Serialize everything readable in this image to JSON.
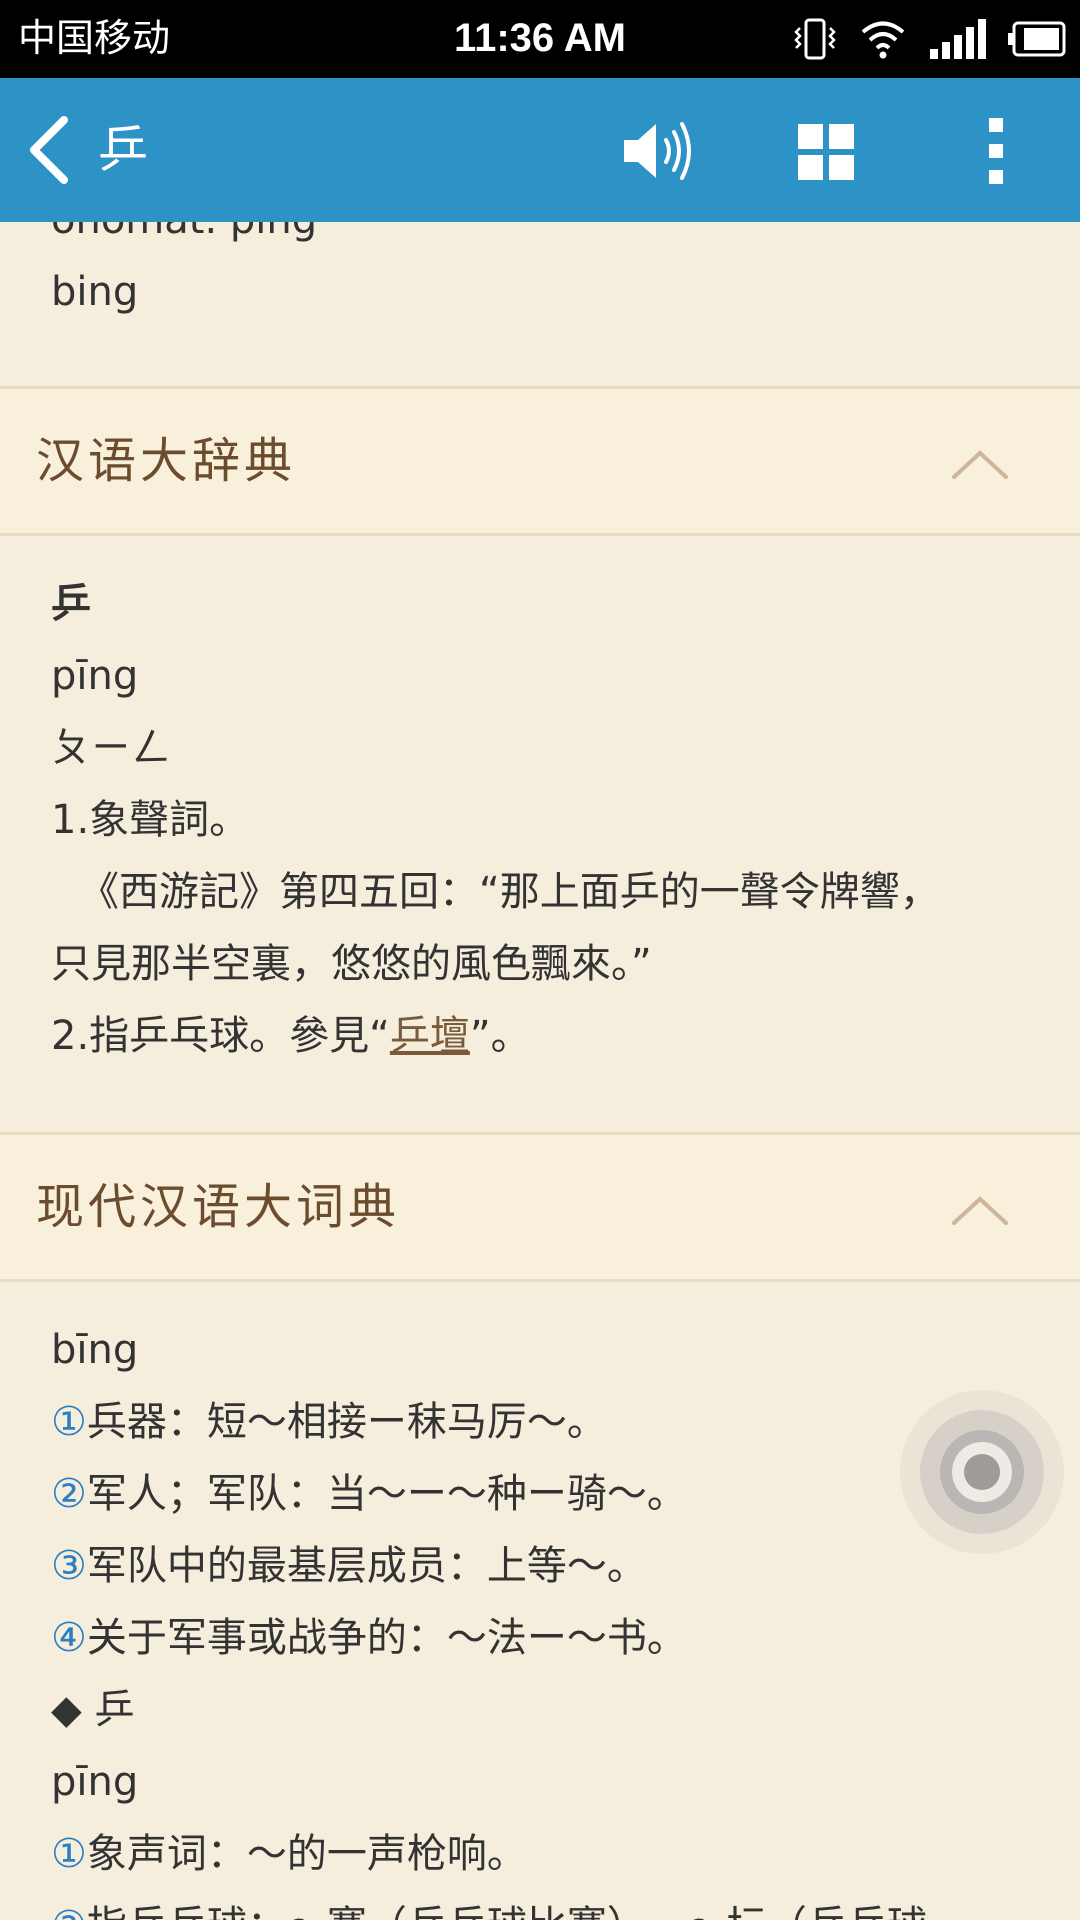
{
  "status_bar": {
    "carrier": "中国移动",
    "time": "11:36 AM"
  },
  "app_bar": {
    "title": "乒",
    "icons": [
      "back-icon",
      "speaker-icon",
      "grid-icon",
      "more-icon"
    ]
  },
  "partial_top": {
    "line1": "onomat. ping",
    "line2": "bing"
  },
  "sections": [
    {
      "title": "汉语大辞典",
      "lines": [
        "乒",
        "pīng",
        "ㄆㄧㄥ",
        "1.象聲詞。",
        "《西游記》第四五回：“那上面乒的一聲令牌響，",
        "只見那半空裏，悠悠的風色飄來。”"
      ],
      "last_line_prefix": "2.指乒乓球。參見“",
      "link_text": "乒壇",
      "last_line_suffix": "”。"
    },
    {
      "title": "现代汉语大词典",
      "lines_a": [
        "bīng"
      ],
      "defs": [
        {
          "num": "①",
          "text": "兵器：短～相接ー秣马厉～。"
        },
        {
          "num": "②",
          "text": "军人；军队：当～ー～种ー骑～。"
        },
        {
          "num": "③",
          "text": "军队中的最基层成员：上等～。"
        },
        {
          "num": "④",
          "text": "关于军事或战争的：～法ー～书。"
        }
      ],
      "variant": "◆ 乒",
      "pinyin2": "pīng",
      "defs2": [
        {
          "num": "①",
          "text": "象声词：～的一声枪响。"
        },
        {
          "num": "②",
          "text": "指乒乓球：～赛（乒乓球比赛）ー～坛（乒乓球"
        }
      ]
    }
  ],
  "colors": {
    "app_bar": "#2d92c6",
    "background": "#f5eedd",
    "section_header": "#f8f0da",
    "section_title": "#6b4c2e",
    "circled_numbers": "#2d7fc0"
  }
}
